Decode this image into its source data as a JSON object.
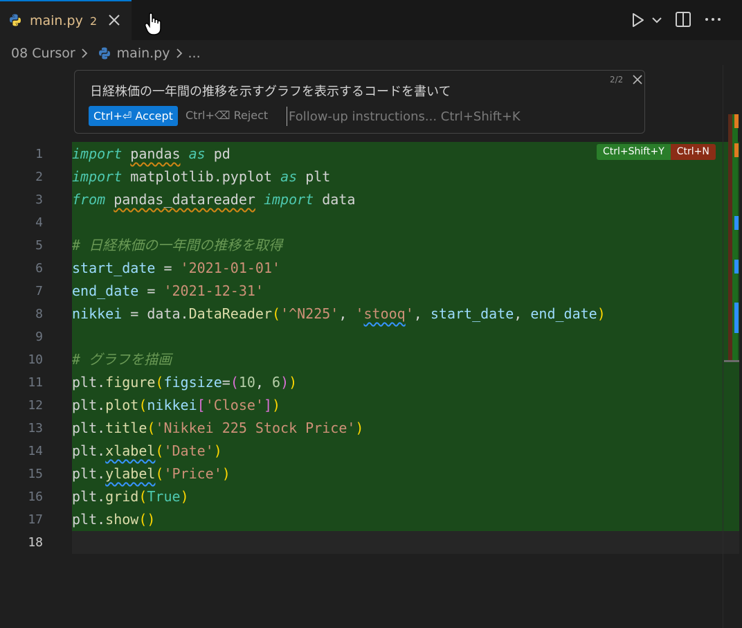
{
  "tab": {
    "filename": "main.py",
    "problem_count": "2"
  },
  "breadcrumb": {
    "folder": "08 Cursor",
    "file": "main.py",
    "more": "..."
  },
  "prompt_panel": {
    "question": "日経株価の一年間の推移を示すグラフを表示するコードを書いて",
    "page_indicator": "2/2",
    "accept_label": "Ctrl+⏎ Accept",
    "reject_label": "Ctrl+⌫ Reject",
    "followup_placeholder": "Follow-up instructions... Ctrl+Shift+K"
  },
  "diff_badges": {
    "accept": "Ctrl+Shift+Y",
    "reject": "Ctrl+N"
  },
  "code_lines": [
    "import pandas as pd",
    "import matplotlib.pyplot as plt",
    "from pandas_datareader import data",
    "",
    "# 日経株価の一年間の推移を取得",
    "start_date = '2021-01-01'",
    "end_date = '2021-12-31'",
    "nikkei = data.DataReader('^N225', 'stooq', start_date, end_date)",
    "",
    "# グラフを描画",
    "plt.figure(figsize=(10, 6))",
    "plt.plot(nikkei['Close'])",
    "plt.title('Nikkei 225 Stock Price')",
    "plt.xlabel('Date')",
    "plt.ylabel('Price')",
    "plt.grid(True)",
    "plt.show()",
    ""
  ],
  "line_numbers": [
    "1",
    "2",
    "3",
    "4",
    "5",
    "6",
    "7",
    "8",
    "9",
    "10",
    "11",
    "12",
    "13",
    "14",
    "15",
    "16",
    "17",
    "18"
  ],
  "active_line": "18",
  "colors": {
    "accent": "#0078d4",
    "diff_added_bg": "#1b4a1b",
    "warning": "#e2c08d"
  }
}
